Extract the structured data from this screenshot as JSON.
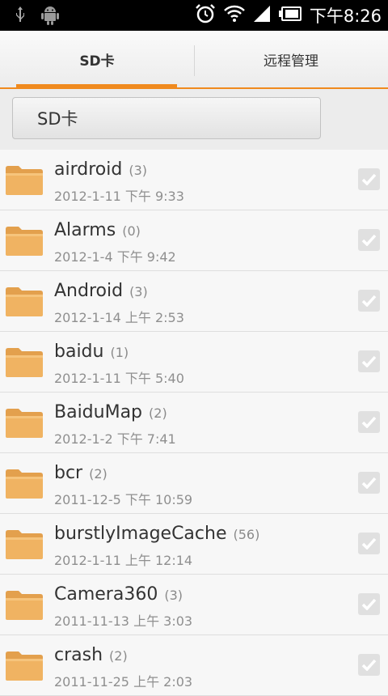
{
  "status_bar": {
    "left_icons": [
      "usb-icon",
      "android-icon"
    ],
    "right_icons": [
      "alarm-icon",
      "wifi-icon",
      "signal-icon",
      "battery-icon"
    ],
    "time": "下午8:26"
  },
  "tabs": [
    {
      "label": "SD卡",
      "selected": true
    },
    {
      "label": "远程管理",
      "selected": false
    }
  ],
  "path_button": "SD卡",
  "accent_color": "#f08a1e",
  "folder_color": "#e9a752",
  "files": [
    {
      "name": "airdroid",
      "count": "(3)",
      "date": "2012-1-11 下午 9:33"
    },
    {
      "name": "Alarms",
      "count": "(0)",
      "date": "2012-1-4 下午 9:42"
    },
    {
      "name": "Android",
      "count": "(3)",
      "date": "2012-1-14 上午 2:53"
    },
    {
      "name": "baidu",
      "count": "(1)",
      "date": "2012-1-11 下午 5:40"
    },
    {
      "name": "BaiduMap",
      "count": "(2)",
      "date": "2012-1-2 下午 7:41"
    },
    {
      "name": "bcr",
      "count": "(2)",
      "date": "2011-12-5 下午 10:59"
    },
    {
      "name": "burstlyImageCache",
      "count": "(56)",
      "date": "2012-1-11 上午 12:14"
    },
    {
      "name": "Camera360",
      "count": "(3)",
      "date": "2011-11-13 上午 3:03"
    },
    {
      "name": "crash",
      "count": "(2)",
      "date": "2011-11-25 上午 2:03"
    }
  ]
}
